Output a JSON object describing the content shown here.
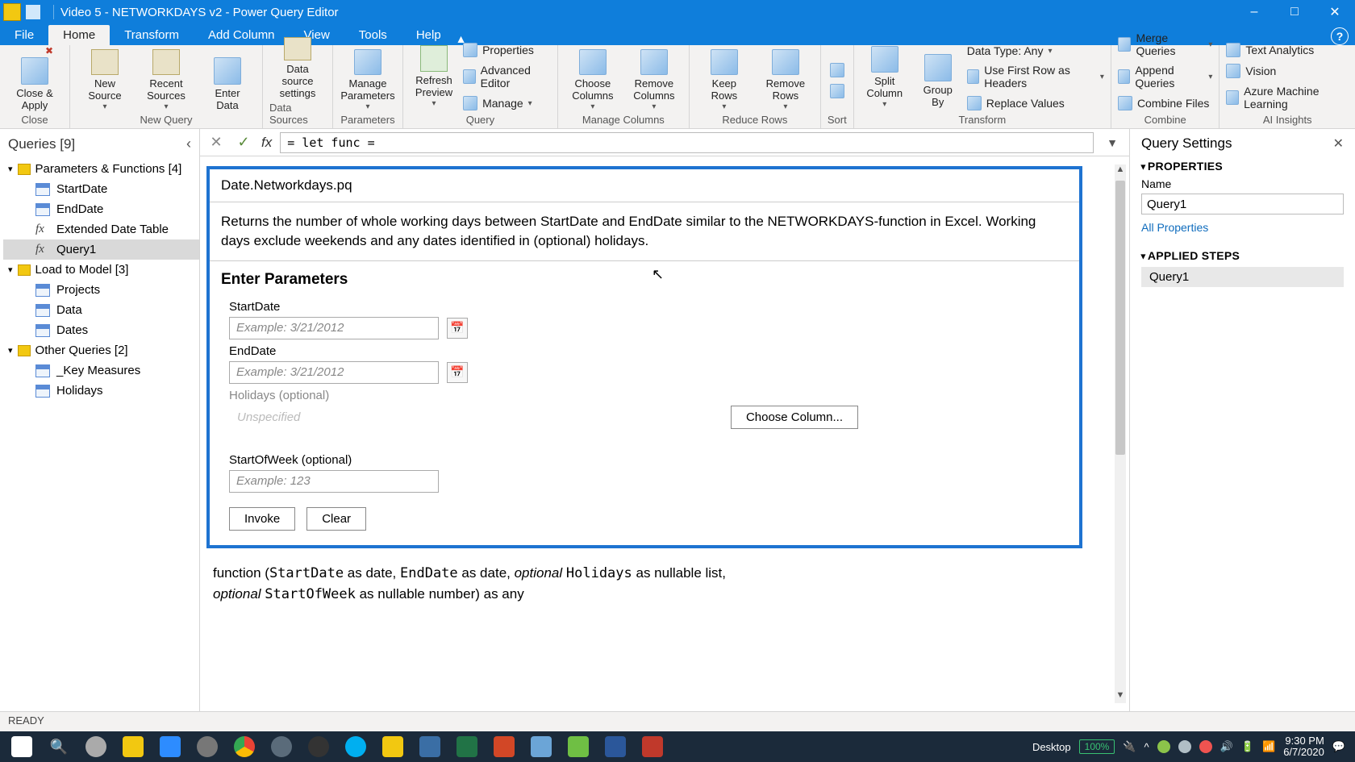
{
  "titlebar": {
    "title": "Video 5 - NETWORKDAYS v2 - Power Query Editor"
  },
  "menu": {
    "file": "File",
    "home": "Home",
    "transform": "Transform",
    "addcolumn": "Add Column",
    "view": "View",
    "tools": "Tools",
    "help": "Help"
  },
  "ribbon": {
    "close": "Close &\nApply",
    "close_group": "Close",
    "new_source": "New\nSource",
    "recent": "Recent\nSources",
    "enter": "Enter\nData",
    "newquery_group": "New Query",
    "ds_settings": "Data source\nsettings",
    "ds_group": "Data Sources",
    "manage_params": "Manage\nParameters",
    "params_group": "Parameters",
    "refresh": "Refresh\nPreview",
    "properties": "Properties",
    "adv_editor": "Advanced Editor",
    "manage": "Manage",
    "query_group": "Query",
    "choose_cols": "Choose\nColumns",
    "remove_cols": "Remove\nColumns",
    "managecols_group": "Manage Columns",
    "keep_rows": "Keep\nRows",
    "remove_rows": "Remove\nRows",
    "reducerows_group": "Reduce Rows",
    "sort_group": "Sort",
    "split": "Split\nColumn",
    "groupby": "Group\nBy",
    "datatype": "Data Type: Any",
    "firstrow": "Use First Row as Headers",
    "replace": "Replace Values",
    "transform_group": "Transform",
    "merge": "Merge Queries",
    "append": "Append Queries",
    "combine_files": "Combine Files",
    "combine_group": "Combine",
    "ta": "Text Analytics",
    "vision": "Vision",
    "aml": "Azure Machine Learning",
    "ai_group": "AI Insights"
  },
  "queries": {
    "header": "Queries [9]",
    "g1": "Parameters & Functions [4]",
    "g1_items": [
      "StartDate",
      "EndDate",
      "Extended Date Table",
      "Query1"
    ],
    "g2": "Load to Model [3]",
    "g2_items": [
      "Projects",
      "Data",
      "Dates"
    ],
    "g3": "Other Queries [2]",
    "g3_items": [
      "_Key Measures",
      "Holidays"
    ]
  },
  "formula": {
    "text": "= let func ="
  },
  "func": {
    "title": "Date.Networkdays.pq",
    "desc": "Returns the number of whole working days between StartDate and EndDate similar to the NETWORKDAYS-function in Excel. Working days exclude weekends and any dates identified in (optional) holidays.",
    "enter": "Enter Parameters",
    "p1": "StartDate",
    "p1_ph": "Example: 3/21/2012",
    "p2": "EndDate",
    "p2_ph": "Example: 3/21/2012",
    "p3": "Holidays (optional)",
    "p3_unspec": "Unspecified",
    "choose": "Choose Column...",
    "p4": "StartOfWeek (optional)",
    "p4_ph": "Example: 123",
    "invoke": "Invoke",
    "clear": "Clear",
    "sig1a": "function (",
    "sig1b": "StartDate",
    "sig1c": " as date, ",
    "sig1d": "EndDate",
    "sig1e": " as date, ",
    "sig1f": "optional ",
    "sig1g": "Holidays",
    "sig1h": " as nullable list,",
    "sig2a": "optional ",
    "sig2b": "StartOfWeek",
    "sig2c": " as nullable number) as any"
  },
  "settings": {
    "header": "Query Settings",
    "props": "PROPERTIES",
    "name_label": "Name",
    "name_value": "Query1",
    "all_props": "All Properties",
    "steps": "APPLIED STEPS",
    "step1": "Query1"
  },
  "status": {
    "ready": "READY"
  },
  "taskbar": {
    "desktop": "Desktop",
    "battery": "100%",
    "time": "9:30 PM",
    "date": "6/7/2020"
  }
}
